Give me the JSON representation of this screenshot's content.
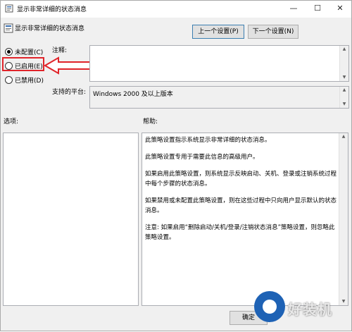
{
  "window": {
    "title": "显示非常详细的状态消息",
    "controls": {
      "minimize": "—",
      "maximize": "☐",
      "close": "✕"
    }
  },
  "header": {
    "policy_name": "显示非常详细的状态消息",
    "prev_button": "上一个设置(P)",
    "next_button": "下一个设置(N)"
  },
  "options": [
    {
      "label": "未配置(C)",
      "selected": true
    },
    {
      "label": "已启用(E)",
      "selected": false
    },
    {
      "label": "已禁用(D)",
      "selected": false
    }
  ],
  "comment": {
    "label": "注释:",
    "value": ""
  },
  "platform": {
    "label": "支持的平台:",
    "value": "Windows 2000 及以上版本"
  },
  "sections": {
    "options_label": "选项:",
    "help_label": "帮助:"
  },
  "help": {
    "paragraphs": [
      "此策略设置指示系统显示非常详细的状态消息。",
      "此策略设置专用于需要此信息的高级用户。",
      "如果启用此策略设置，则系统显示反映启动、关机、登录或注销系统过程中每个步骤的状态消息。",
      "如果禁用或未配置此策略设置，则在这些过程中只向用户显示默认的状态消息。",
      "注意: 如果启用“删除启动/关机/登录/注销状态消息”策略设置，则忽略此策略设置。"
    ]
  },
  "footer": {
    "ok_button": "确定"
  },
  "watermark": {
    "text": "好装机"
  },
  "annotation": {
    "color": "#e0242a"
  }
}
